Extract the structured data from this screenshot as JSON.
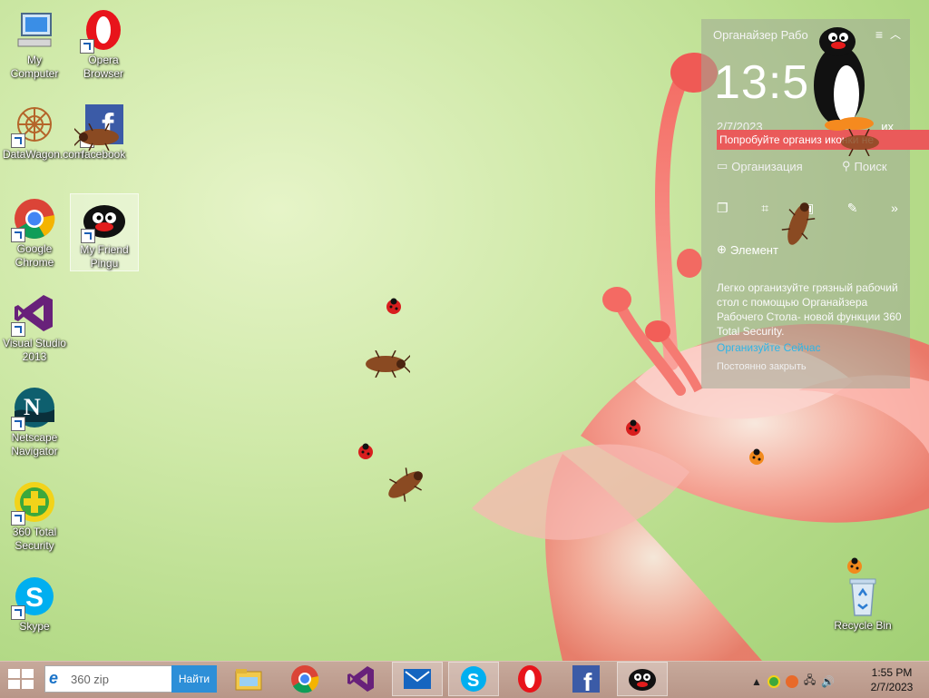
{
  "desktop": {
    "icons": [
      {
        "label": "My Computer",
        "icon": "computer-icon"
      },
      {
        "label": "Opera Browser",
        "icon": "opera-icon"
      },
      {
        "label": "DataWagon.com",
        "icon": "datawagon-icon"
      },
      {
        "label": "facebook",
        "icon": "facebook-icon"
      },
      {
        "label": "Google Chrome",
        "icon": "chrome-icon"
      },
      {
        "label": "My Friend Pingu",
        "icon": "pingu-icon"
      },
      {
        "label": "Visual Studio 2013",
        "icon": "visual-studio-icon"
      },
      {
        "label": "Netscape Navigator",
        "icon": "netscape-icon"
      },
      {
        "label": "360 Total Security",
        "icon": "360-security-icon"
      },
      {
        "label": "Skype",
        "icon": "skype-icon"
      },
      {
        "label": "Recycle Bin",
        "icon": "recycle-bin-icon"
      }
    ]
  },
  "organizer": {
    "title": "Органайзер Рабо",
    "clock": "13:5",
    "date": "2/7/2023",
    "date_suffix": "их",
    "banner": "Попробуйте организ иконки не",
    "organize_label": "Организация",
    "search_label": "Поиск",
    "element_label": "Элемент",
    "description": "Легко организуйте грязный рабочий стол с помощью Органайзера Рабочего Стола- новой функции 360 Total Security.",
    "link": "Организуйте Сейчас",
    "close_forever": "Постоянно закрыть"
  },
  "taskbar": {
    "search_value": "360 zip",
    "search_button": "Найти",
    "apps": [
      "file-explorer-icon",
      "chrome-icon",
      "visual-studio-icon",
      "mail-icon",
      "skype-icon",
      "opera-icon",
      "facebook-icon",
      "pingu-icon"
    ],
    "active_apps": [
      "mail-icon",
      "skype-icon",
      "pingu-icon"
    ],
    "time": "1:55 PM",
    "date": "2/7/2023"
  },
  "colors": {
    "banner": "#ea5a5a",
    "link": "#2db5e8",
    "taskbar": "#c0a092",
    "search_button": "#2d8fd8"
  }
}
